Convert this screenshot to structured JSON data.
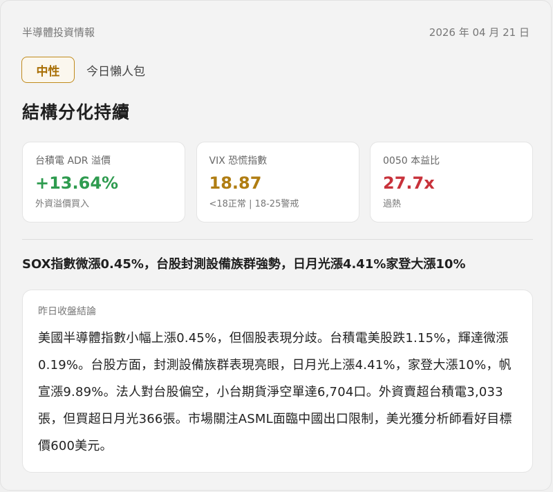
{
  "header": {
    "title": "半導體投資情報",
    "date": "2026 年 04 月 21 日"
  },
  "tag": {
    "label": "中性",
    "subtitle": "今日懶人包"
  },
  "headline": "結構分化持續",
  "metrics": [
    {
      "label": "台積電 ADR 溢價",
      "value": "+13.64%",
      "note": "外資溢價買入",
      "color": "#2e9b4f"
    },
    {
      "label": "VIX 恐慌指數",
      "value": "18.87",
      "note": "<18正常 | 18-25警戒",
      "color": "#b07d12"
    },
    {
      "label": "0050 本益比",
      "value": "27.7x",
      "note": "過熱",
      "color": "#c8323b"
    }
  ],
  "summary": "SOX指數微漲0.45%，台股封測設備族群強勢，日月光漲4.41%家登大漲10%",
  "conclusion": {
    "title": "昨日收盤結論",
    "body": "美國半導體指數小幅上漲0.45%，但個股表現分歧。台積電美股跌1.15%，輝達微漲0.19%。台股方面，封測設備族群表現亮眼，日月光上漲4.41%，家登大漲10%，帆宣漲9.89%。法人對台股偏空，小台期貨淨空單達6,704口。外資賣超台積電3,033張，但買超日月光366張。市場關注ASML面臨中國出口限制，美光獲分析師看好目標價600美元。"
  }
}
